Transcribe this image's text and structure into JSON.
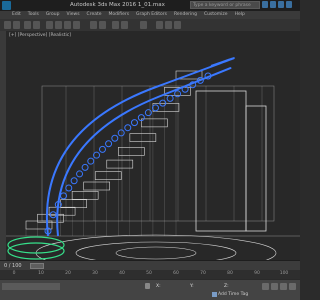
{
  "window": {
    "title": "Autodesk 3ds Max 2016    1_01.max",
    "search_placeholder": "Type a keyword or phrase"
  },
  "menu": [
    "Edit",
    "Tools",
    "Group",
    "Views",
    "Create",
    "Modifiers",
    "Graph Editors",
    "Rendering",
    "Customize",
    "Help"
  ],
  "viewport": {
    "label": "[+] [Perspective] [Realistic]",
    "wire_color": "#d8d8d8",
    "selected_color": "#3a78ff",
    "accent_green": "#36e08a"
  },
  "timeline": {
    "frame_readout": "0 / 100",
    "ticks": [
      "0",
      "10",
      "20",
      "30",
      "40",
      "50",
      "60",
      "70",
      "80",
      "90",
      "100"
    ]
  },
  "status": {
    "x_label": "X:",
    "x_value": "",
    "y_label": "Y:",
    "y_value": "",
    "z_label": "Z:",
    "z_value": "",
    "add_time_tag": "Add Time Tag"
  }
}
